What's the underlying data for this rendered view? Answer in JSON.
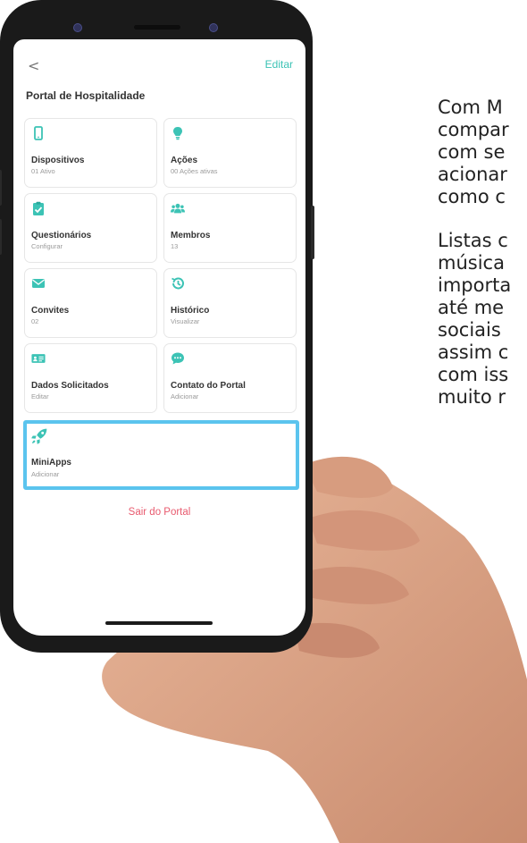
{
  "app": {
    "back_label": "<",
    "edit_label": "Editar",
    "title": "Portal de Hospitalidade"
  },
  "cards": [
    {
      "label": "Dispositivos",
      "sub": "01 Ativo",
      "icon": "smartphone-icon"
    },
    {
      "label": "Ações",
      "sub": "00 Ações ativas",
      "icon": "lightbulb-icon"
    },
    {
      "label": "Questionários",
      "sub": "Configurar",
      "icon": "clipboard-check-icon"
    },
    {
      "label": "Membros",
      "sub": "13",
      "icon": "users-icon"
    },
    {
      "label": "Convites",
      "sub": "02",
      "icon": "envelope-icon"
    },
    {
      "label": "Histórico",
      "sub": "Visualizar",
      "icon": "history-icon"
    },
    {
      "label": "Dados Solicitados",
      "sub": "Editar",
      "icon": "id-card-icon"
    },
    {
      "label": "Contato do Portal",
      "sub": "Adicionar",
      "icon": "chat-bubble-icon"
    }
  ],
  "miniapps": {
    "label": "MiniApps",
    "sub": "Adicionar",
    "icon": "rocket-icon"
  },
  "leave_label": "Sair do Portal",
  "side_text": {
    "paragraph1": [
      "Com M",
      "compar",
      "com se",
      "acionar",
      "como c"
    ],
    "paragraph2": [
      "Listas c",
      "música",
      "importa",
      "até me",
      "sociais",
      "assim c",
      "com iss",
      "muito r"
    ]
  },
  "colors": {
    "accent": "#3cc3b5",
    "highlight_border": "#5bc4ee",
    "danger": "#e85a6e"
  }
}
